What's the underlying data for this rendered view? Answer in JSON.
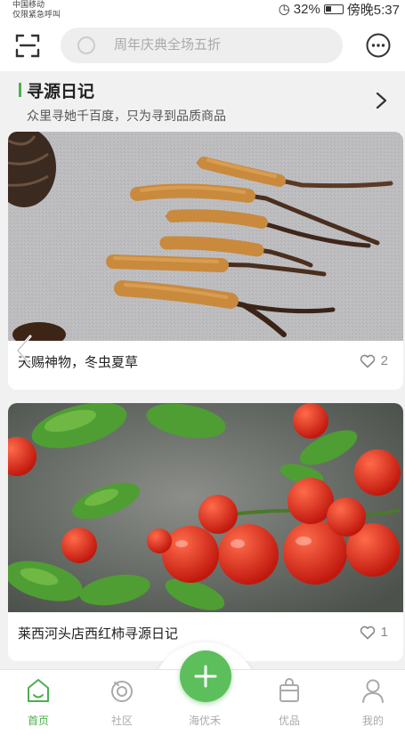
{
  "status_bar": {
    "carrier_line1": "中国移动",
    "carrier_line2": "仅限紧急呼叫",
    "battery": "32%",
    "time": "傍晚5:37"
  },
  "header": {
    "search_placeholder": "周年庆典全场五折"
  },
  "section": {
    "title": "寻源日记",
    "subtitle": "众里寻她千百度，只为寻到品质商品"
  },
  "cards": [
    {
      "title": "天赐神物，冬虫夏草",
      "likes": "2"
    },
    {
      "title": "莱西河头店西红柿寻源日记",
      "likes": "1"
    }
  ],
  "tabs": [
    {
      "label": "首页"
    },
    {
      "label": "社区"
    },
    {
      "label": "海优禾"
    },
    {
      "label": "优品"
    },
    {
      "label": "我的"
    }
  ],
  "colors": {
    "accent": "#4caf50",
    "tab_inactive": "#aaaaaa"
  }
}
